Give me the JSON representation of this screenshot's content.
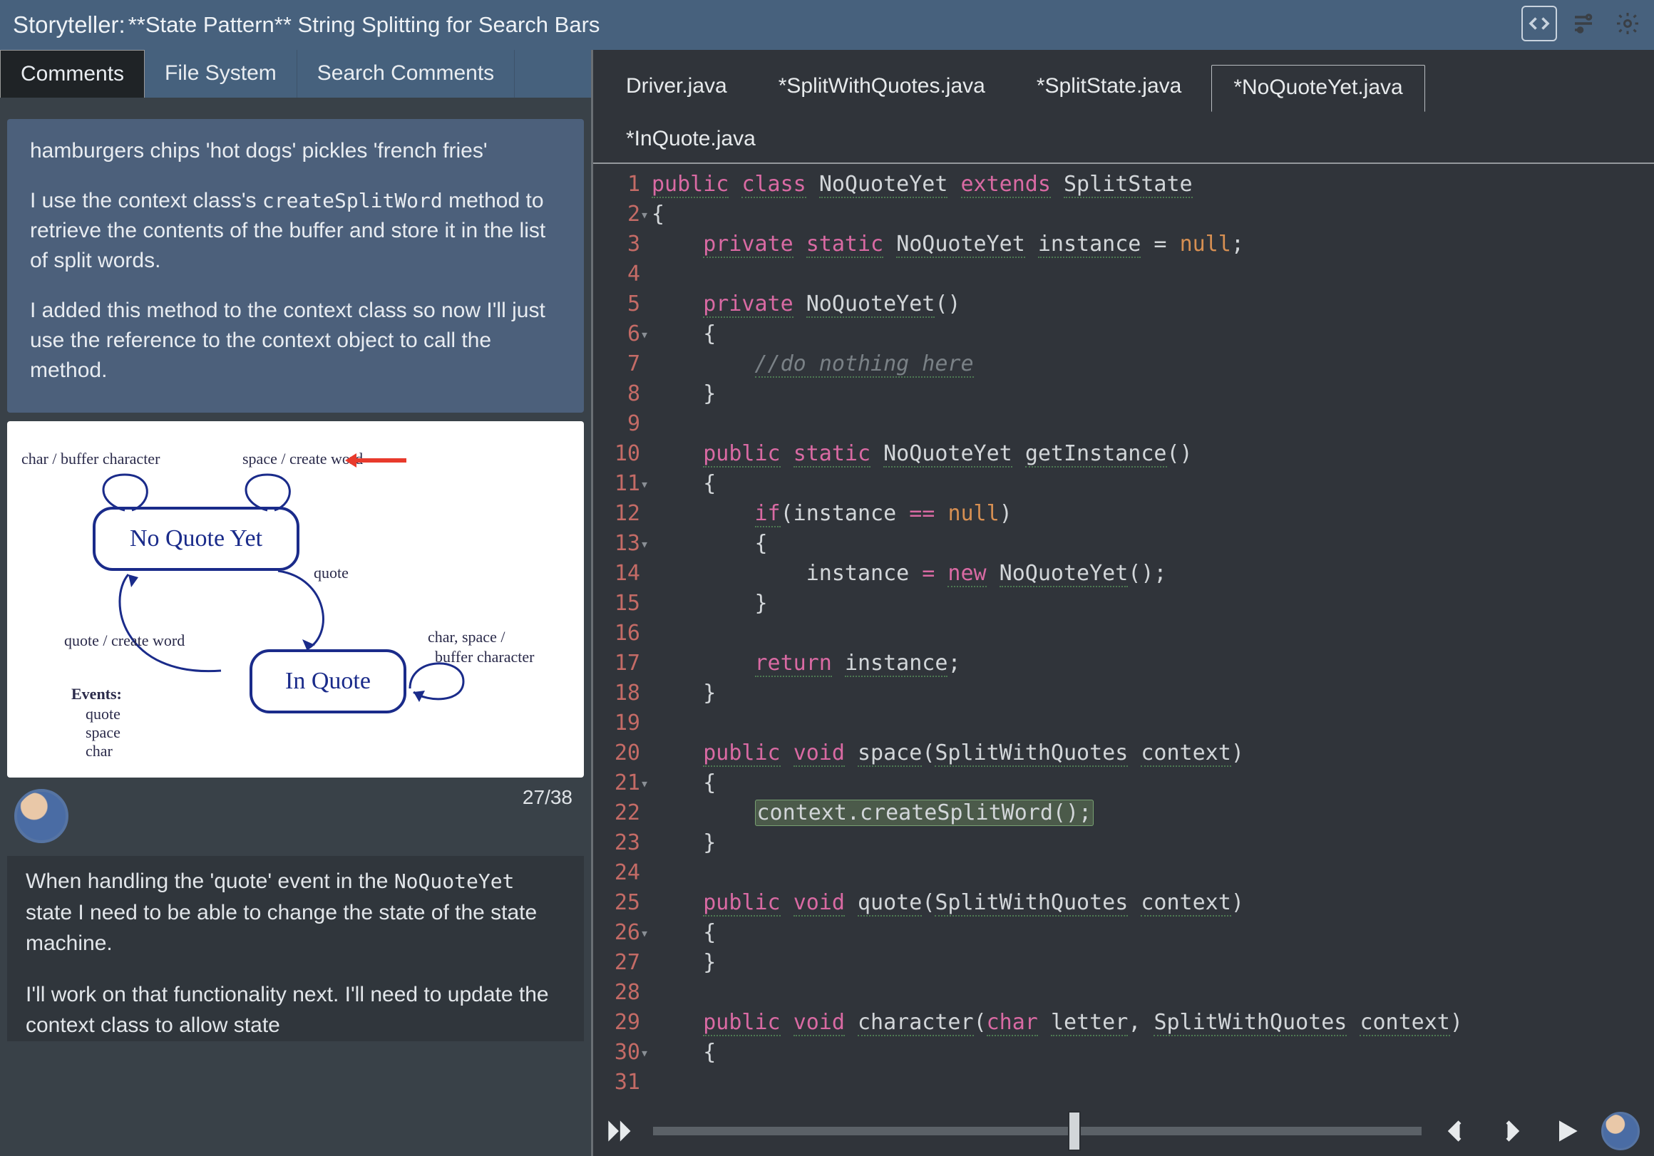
{
  "header": {
    "prefix": "Storyteller:",
    "title": "**State Pattern** String Splitting for Search Bars"
  },
  "left_tabs": [
    "Comments",
    "File System",
    "Search Comments"
  ],
  "left_active_tab": 0,
  "comment1": {
    "para1": "hamburgers chips 'hot dogs' pickles 'french fries'",
    "para2_a": "I use the context class's ",
    "para2_code": "createSplitWord",
    "para2_b": " method to retrieve the contents of the buffer and store it in the list of split words.",
    "para3": "I added this method to the context class so now I'll just use the reference to the context object to call the method."
  },
  "diagram": {
    "char_buffer": "char / buffer character",
    "space_create": "space / create word",
    "no_quote_yet": "No Quote Yet",
    "quote_lbl": "quote",
    "quote_create": "quote / create word",
    "in_quote": "In Quote",
    "char_space": "char, space /",
    "buffer_char": "buffer character",
    "events_head": "Events:",
    "ev1": "quote",
    "ev2": "space",
    "ev3": "char"
  },
  "counter": "27/38",
  "comment2": {
    "p1_a": "When handling the 'quote' event in the ",
    "p1_code": "NoQuoteYet",
    "p1_b": " state I need to be able to change the state of the state machine.",
    "p2": "I'll work on that functionality next. I'll need to update the context class to allow state"
  },
  "file_tabs_row1": [
    "Driver.java",
    "*SplitWithQuotes.java",
    "*SplitState.java",
    "*NoQuoteYet.java"
  ],
  "file_tabs_row2": [
    "*InQuote.java"
  ],
  "file_active": "*NoQuoteYet.java",
  "code_lines": [
    {
      "n": 1,
      "fold": "",
      "html": "<span class='kw'>public</span> <span class='kw'>class</span> <span class='id'>NoQuoteYet</span> <span class='kw'>extends</span> <span class='id'>SplitState</span>"
    },
    {
      "n": 2,
      "fold": "-",
      "html": "{"
    },
    {
      "n": 3,
      "fold": "",
      "html": "    <span class='kw'>private</span> <span class='kw'>static</span> <span class='id'>NoQuoteYet</span> <span class='id'>instance</span> = <span class='null'>null</span>;"
    },
    {
      "n": 4,
      "fold": "",
      "html": ""
    },
    {
      "n": 5,
      "fold": "",
      "html": "    <span class='kw'>private</span> <span class='id'>NoQuoteYet</span>()"
    },
    {
      "n": 6,
      "fold": "-",
      "html": "    {"
    },
    {
      "n": 7,
      "fold": "",
      "html": "        <span class='cmt'>//do nothing here</span>"
    },
    {
      "n": 8,
      "fold": "",
      "html": "    }"
    },
    {
      "n": 9,
      "fold": "",
      "html": ""
    },
    {
      "n": 10,
      "fold": "",
      "html": "    <span class='kw'>public</span> <span class='kw'>static</span> <span class='id'>NoQuoteYet</span> <span class='id'>getInstance</span>()"
    },
    {
      "n": 11,
      "fold": "-",
      "html": "    {"
    },
    {
      "n": 12,
      "fold": "",
      "html": "        <span class='kw'>if</span>(instance <span class='op'>==</span> <span class='null'>null</span>)"
    },
    {
      "n": 13,
      "fold": "-",
      "html": "        {"
    },
    {
      "n": 14,
      "fold": "",
      "html": "            instance <span class='op'>=</span> <span class='kw'>new</span> <span class='id'>NoQuoteYet</span>();"
    },
    {
      "n": 15,
      "fold": "",
      "html": "        }"
    },
    {
      "n": 16,
      "fold": "",
      "html": ""
    },
    {
      "n": 17,
      "fold": "",
      "html": "        <span class='kw'>return</span> <span class='id'>instance</span>;"
    },
    {
      "n": 18,
      "fold": "",
      "html": "    }"
    },
    {
      "n": 19,
      "fold": "",
      "html": ""
    },
    {
      "n": 20,
      "fold": "",
      "html": "    <span class='kw'>public</span> <span class='kw'>void</span> <span class='id'>space</span>(<span class='id'>SplitWithQuotes</span> <span class='id'>context</span>)"
    },
    {
      "n": 21,
      "fold": "-",
      "html": "    {"
    },
    {
      "n": 22,
      "fold": "",
      "html": "        <span class='hl'>context.createSplitWord();</span>"
    },
    {
      "n": 23,
      "fold": "",
      "html": "    }"
    },
    {
      "n": 24,
      "fold": "",
      "html": ""
    },
    {
      "n": 25,
      "fold": "",
      "html": "    <span class='kw'>public</span> <span class='kw'>void</span> <span class='id'>quote</span>(<span class='id'>SplitWithQuotes</span> <span class='id'>context</span>)"
    },
    {
      "n": 26,
      "fold": "-",
      "html": "    {"
    },
    {
      "n": 27,
      "fold": "",
      "html": "    }"
    },
    {
      "n": 28,
      "fold": "",
      "html": ""
    },
    {
      "n": 29,
      "fold": "",
      "html": "    <span class='kw'>public</span> <span class='kw'>void</span> <span class='id'>character</span>(<span class='kw'>char</span> <span class='id'>letter</span>, <span class='id'>SplitWithQuotes</span> <span class='id'>context</span>)"
    },
    {
      "n": 30,
      "fold": "-",
      "html": "    {"
    },
    {
      "n": 31,
      "fold": "",
      "html": ""
    }
  ]
}
